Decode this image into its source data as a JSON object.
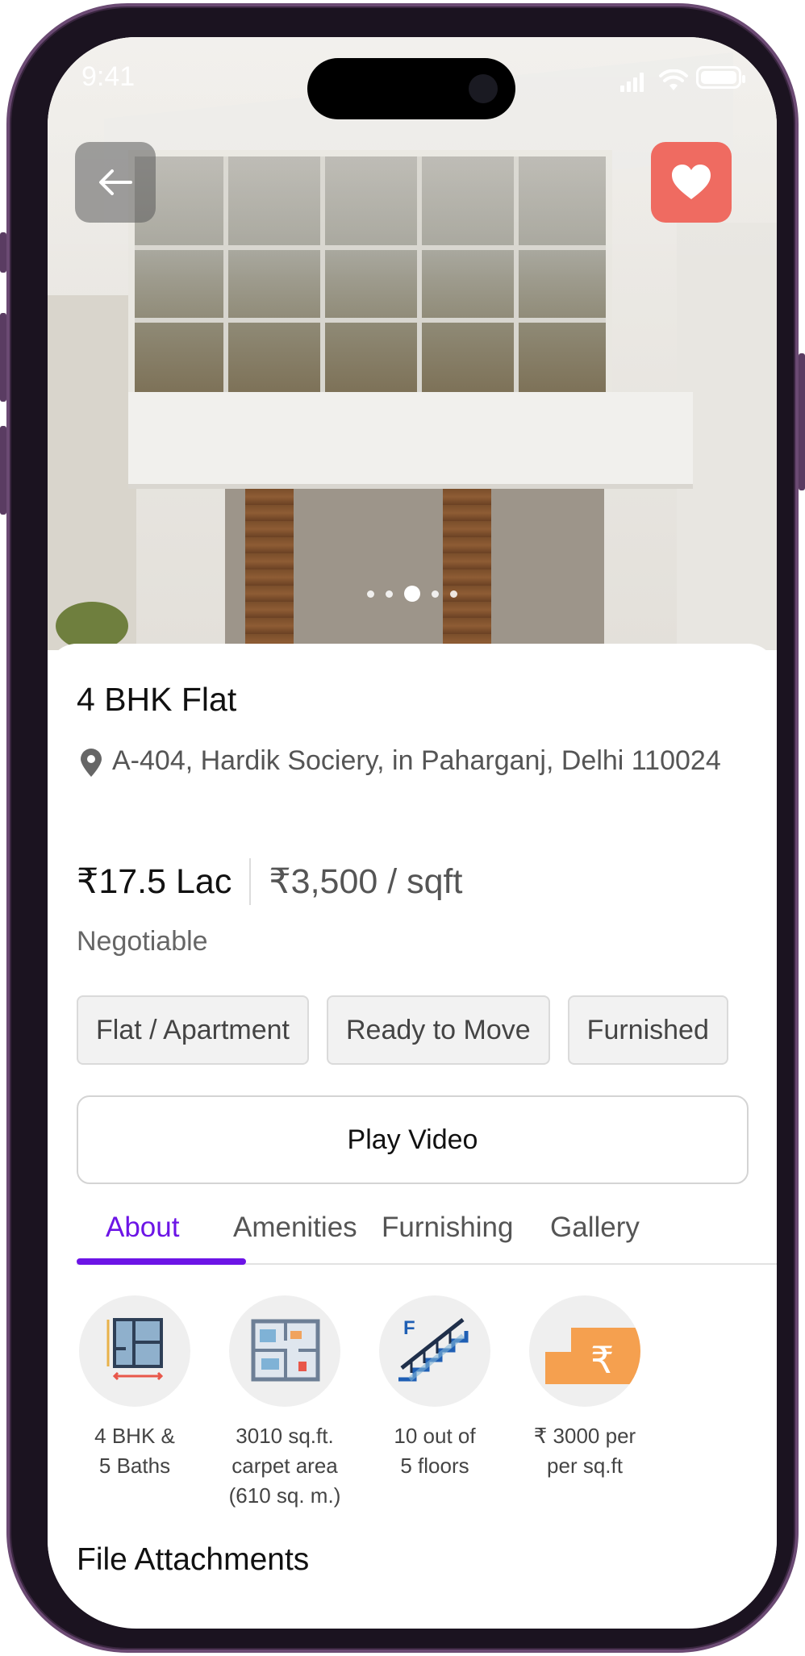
{
  "status_bar": {
    "time": "9:41"
  },
  "listing": {
    "title": "4 BHK Flat",
    "address": "A-404, Hardik Sociery, in Paharganj, Delhi 110024",
    "price": "₹17.5 Lac",
    "price_per_sqft": "₹3,500 / sqft",
    "negotiable": "Negotiable"
  },
  "chips": [
    "Flat / Apartment",
    "Ready to Move",
    "Furnished"
  ],
  "play_video_label": "Play Video",
  "tabs": [
    {
      "label": "About",
      "active": true
    },
    {
      "label": "Amenities",
      "active": false
    },
    {
      "label": "Furnishing",
      "active": false
    },
    {
      "label": "Gallery",
      "active": false
    }
  ],
  "features": [
    {
      "icon": "floorplan-dimensions-icon",
      "label": "4 BHK &\n5 Baths"
    },
    {
      "icon": "carpet-area-floorplan-icon",
      "label": "3010 sq.ft.\ncarpet area\n(610 sq. m.)"
    },
    {
      "icon": "staircase-floor-icon",
      "label": "10 out of\n5 floors"
    },
    {
      "icon": "rupee-price-icon",
      "label": "₹ 3000 per\nper sq.ft"
    }
  ],
  "section_title": "File Attachments",
  "carousel": {
    "count": 5,
    "active_index": 2
  },
  "favorite": true,
  "colors": {
    "accent": "#6c14e6",
    "favorite": "#ef6b61",
    "chip_bg": "#f2f2f2"
  }
}
